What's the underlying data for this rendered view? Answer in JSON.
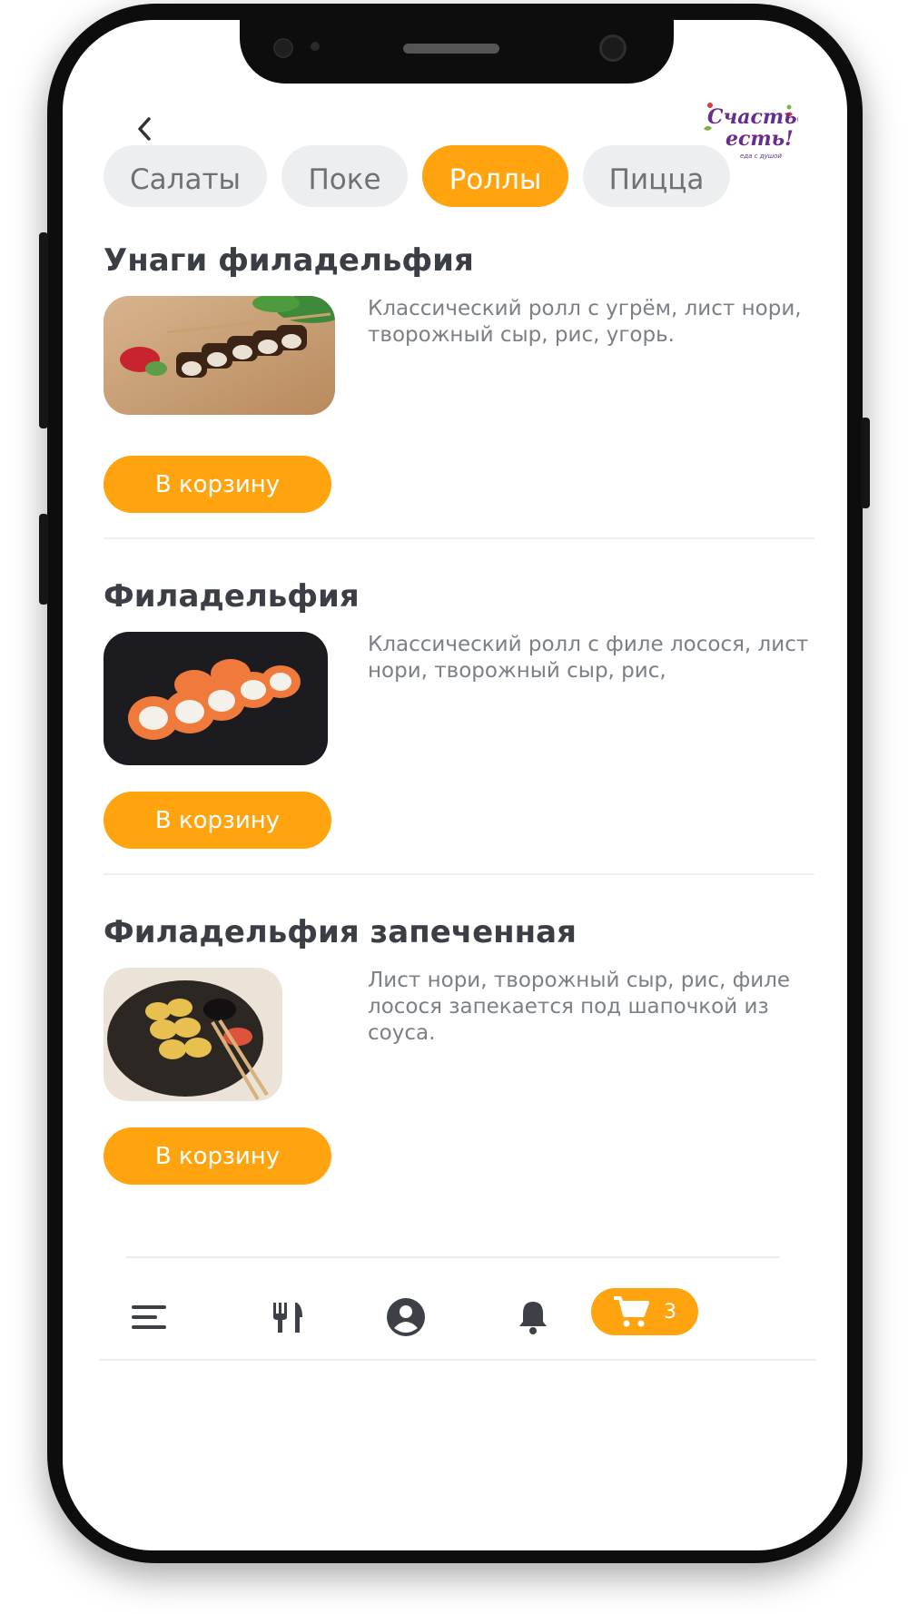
{
  "header": {
    "back_icon": "chevron-left-icon",
    "logo_line1": "Счастье",
    "logo_line2": "есть!",
    "logo_tagline": "еда с душой",
    "logo_colors": {
      "text": "#6a2c8c",
      "accent_red": "#e03a3a",
      "accent_green": "#7cb342"
    }
  },
  "categories": [
    {
      "label": "Салаты",
      "active": false
    },
    {
      "label": "Поке",
      "active": false
    },
    {
      "label": "Роллы",
      "active": true
    },
    {
      "label": "Пицца",
      "active": false
    }
  ],
  "products": [
    {
      "title": "Унаги филадельфия",
      "description": "Классический ролл с угрём, лист нори, творожный сыр, рис, угорь.",
      "button_label": "В корзину"
    },
    {
      "title": "Филадельфия",
      "description": "Классический ролл с филе лосося, лист нори, творожный сыр, рис,",
      "button_label": "В корзину"
    },
    {
      "title": "Филадельфия запеченная",
      "description": "Лист нори, творожный сыр, рис, филе лосося запекается под шапочкой из соуса.",
      "button_label": "В корзину"
    }
  ],
  "tabbar": {
    "items": [
      "menu-icon",
      "restaurant-icon",
      "account-icon",
      "bell-icon",
      "cart-icon"
    ],
    "cart_count": "3"
  },
  "colors": {
    "accent": "#ffa30f",
    "chip_inactive_bg": "#eceeef",
    "title_text": "#3b3f45",
    "body_text": "#7b8087",
    "icon_dark": "#3d4147"
  }
}
